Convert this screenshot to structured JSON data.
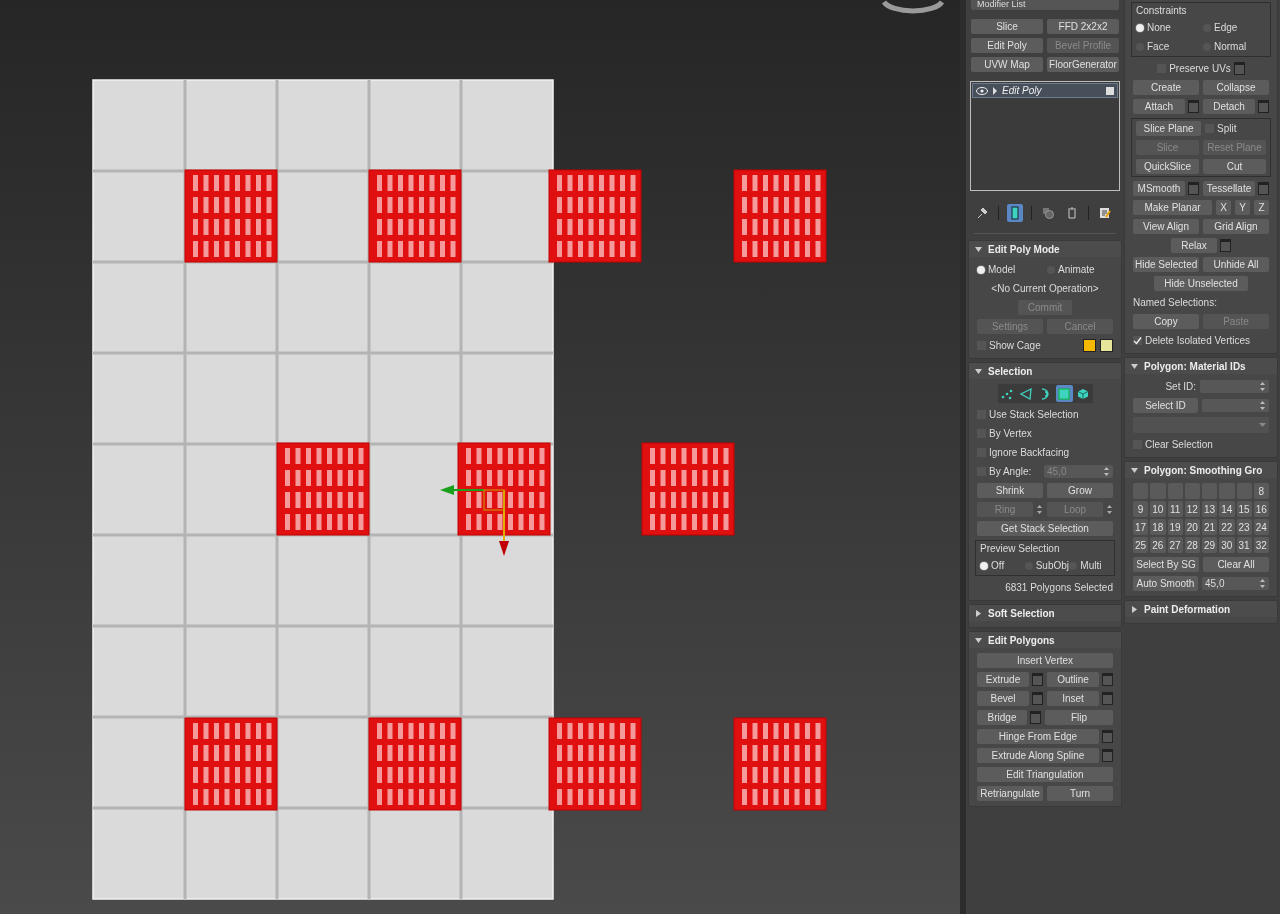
{
  "modifier_list": {
    "label": "Modifier List"
  },
  "modifier_buttons": [
    {
      "label": "Slice",
      "disabled": false
    },
    {
      "label": "FFD 2x2x2",
      "disabled": false
    },
    {
      "label": "Edit Poly",
      "disabled": false
    },
    {
      "label": "Bevel Profile",
      "disabled": true
    },
    {
      "label": "UVW Map",
      "disabled": false
    },
    {
      "label": "FloorGenerator",
      "disabled": false
    }
  ],
  "stack": [
    {
      "label": "Edit Poly",
      "selected": true
    }
  ],
  "stack_tools": [
    {
      "kind": "pin",
      "selected": false
    },
    {
      "kind": "show_end",
      "selected": true
    },
    {
      "kind": "unique",
      "selected": false
    },
    {
      "kind": "remove",
      "selected": false
    },
    {
      "kind": "configure",
      "selected": false
    }
  ],
  "columns": [
    {
      "sections": [
        {
          "title": "Edit Poly Mode",
          "expanded": true,
          "rows": [
            [
              {
                "kind": "radio",
                "label": "Model",
                "selected": true
              },
              {
                "kind": "radio",
                "label": "Animate",
                "selected": false
              }
            ],
            [
              {
                "kind": "text",
                "label": "<No Current Operation>"
              }
            ],
            [
              {
                "kind": "small_button",
                "label": "Commit",
                "disabled": true
              }
            ],
            [
              {
                "kind": "button",
                "label": "Settings",
                "disabled": true
              },
              {
                "kind": "button",
                "label": "Cancel",
                "disabled": true
              }
            ],
            [
              {
                "kind": "check",
                "label": "Show Cage",
                "checked": false
              },
              {
                "kind": "swatch",
                "color": "#f5b800"
              },
              {
                "kind": "swatch",
                "color": "#e6e49a"
              }
            ]
          ]
        },
        {
          "title": "Selection",
          "expanded": true,
          "rows": [
            [
              {
                "kind": "subobjects",
                "levels": [
                  {
                    "kind": "vertex",
                    "selected": false
                  },
                  {
                    "kind": "edge",
                    "selected": false
                  },
                  {
                    "kind": "border",
                    "selected": false
                  },
                  {
                    "kind": "polygon",
                    "selected": true
                  },
                  {
                    "kind": "element",
                    "selected": false
                  }
                ]
              }
            ],
            [
              {
                "kind": "check",
                "label": "Use Stack Selection",
                "checked": false
              }
            ],
            [
              {
                "kind": "check",
                "label": "By Vertex",
                "checked": false
              }
            ],
            [
              {
                "kind": "check",
                "label": "Ignore Backfacing",
                "checked": false
              }
            ],
            [
              {
                "kind": "check",
                "label": "By Angle:",
                "checked": false
              },
              {
                "kind": "spinner",
                "value": "45,0",
                "disabled": true
              }
            ],
            [
              {
                "kind": "button",
                "label": "Shrink",
                "disabled": false
              },
              {
                "kind": "button",
                "label": "Grow",
                "disabled": false
              }
            ],
            [
              {
                "kind": "spin_button",
                "label": "Ring",
                "disabled": true
              },
              {
                "kind": "spin_button",
                "label": "Loop",
                "disabled": true
              }
            ],
            [
              {
                "kind": "button",
                "label": "Get Stack Selection",
                "disabled": false
              }
            ],
            {
              "kind": "group",
              "title": "Preview Selection",
              "rows": [
                [
                  {
                    "kind": "radio",
                    "label": "Off",
                    "selected": true
                  },
                  {
                    "kind": "radio",
                    "label": "SubObj",
                    "selected": false
                  },
                  {
                    "kind": "radio",
                    "label": "Multi",
                    "selected": false
                  }
                ]
              ]
            },
            [
              {
                "kind": "status",
                "label": "6831 Polygons Selected"
              }
            ]
          ]
        },
        {
          "title": "Soft Selection",
          "expanded": false
        },
        {
          "title": "Edit Polygons",
          "expanded": true,
          "rows": [
            [
              {
                "kind": "button",
                "label": "Insert Vertex",
                "disabled": false
              }
            ],
            [
              {
                "kind": "setting_button",
                "label": "Extrude",
                "disabled": false
              },
              {
                "kind": "setting_button",
                "label": "Outline",
                "disabled": false
              }
            ],
            [
              {
                "kind": "setting_button",
                "label": "Bevel",
                "disabled": false
              },
              {
                "kind": "setting_button",
                "label": "Inset",
                "disabled": false
              }
            ],
            [
              {
                "kind": "setting_button",
                "label": "Bridge",
                "disabled": false
              },
              {
                "kind": "button",
                "label": "Flip",
                "disabled": false
              }
            ],
            [
              {
                "kind": "setting_button",
                "label": "Hinge From Edge",
                "disabled": false
              }
            ],
            [
              {
                "kind": "setting_button",
                "label": "Extrude Along Spline",
                "disabled": false
              }
            ],
            [
              {
                "kind": "button",
                "label": "Edit Triangulation",
                "disabled": false
              }
            ],
            [
              {
                "kind": "button",
                "label": "Retriangulate",
                "disabled": false
              },
              {
                "kind": "button",
                "label": "Turn",
                "disabled": false
              }
            ]
          ]
        }
      ]
    },
    {
      "sections": [
        {
          "rows": [
            {
              "kind": "group",
              "title": "Constraints",
              "rows": [
                [
                  {
                    "kind": "radio",
                    "label": "None",
                    "selected": true
                  },
                  {
                    "kind": "radio",
                    "label": "Edge",
                    "selected": false
                  }
                ],
                [
                  {
                    "kind": "radio",
                    "label": "Face",
                    "selected": false
                  },
                  {
                    "kind": "radio",
                    "label": "Normal",
                    "selected": false
                  }
                ]
              ]
            },
            [
              {
                "kind": "check_setting",
                "label": "Preserve UVs",
                "checked": false
              }
            ],
            [
              {
                "kind": "button",
                "label": "Create",
                "disabled": false
              },
              {
                "kind": "button",
                "label": "Collapse",
                "disabled": false
              }
            ],
            [
              {
                "kind": "setting_button",
                "label": "Attach",
                "disabled": false
              },
              {
                "kind": "setting_button",
                "label": "Detach",
                "disabled": false
              }
            ],
            {
              "kind": "group",
              "rows": [
                [
                  {
                    "kind": "button",
                    "label": "Slice Plane",
                    "disabled": false
                  },
                  {
                    "kind": "check",
                    "label": "Split",
                    "checked": false
                  }
                ],
                [
                  {
                    "kind": "button",
                    "label": "Slice",
                    "disabled": true
                  },
                  {
                    "kind": "button",
                    "label": "Reset Plane",
                    "disabled": true
                  }
                ],
                [
                  {
                    "kind": "button",
                    "label": "QuickSlice",
                    "disabled": false
                  },
                  {
                    "kind": "button",
                    "label": "Cut",
                    "disabled": false
                  }
                ]
              ]
            },
            [
              {
                "kind": "setting_button",
                "label": "MSmooth",
                "disabled": false
              },
              {
                "kind": "setting_button",
                "label": "Tessellate",
                "disabled": false
              }
            ],
            [
              {
                "kind": "button",
                "label": "Make Planar",
                "disabled": false
              },
              {
                "kind": "axis_button",
                "label": "X",
                "disabled": false
              },
              {
                "kind": "axis_button",
                "label": "Y",
                "disabled": false
              },
              {
                "kind": "axis_button",
                "label": "Z",
                "disabled": false
              }
            ],
            [
              {
                "kind": "button",
                "label": "View Align",
                "disabled": false
              },
              {
                "kind": "button",
                "label": "Grid Align",
                "disabled": false
              }
            ],
            [
              {
                "kind": "small_setting",
                "label": "Relax",
                "disabled": false
              }
            ],
            [
              {
                "kind": "button",
                "label": "Hide Selected",
                "disabled": false
              },
              {
                "kind": "button",
                "label": "Unhide All",
                "disabled": false
              }
            ],
            [
              {
                "kind": "small_button",
                "label": "Hide Unselected",
                "disabled": false
              }
            ],
            [
              {
                "kind": "label",
                "label": "Named Selections:"
              }
            ],
            [
              {
                "kind": "button",
                "label": "Copy",
                "disabled": false
              },
              {
                "kind": "button",
                "label": "Paste",
                "disabled": true
              }
            ],
            [
              {
                "kind": "check",
                "label": "Delete Isolated Vertices",
                "checked": true
              }
            ]
          ]
        },
        {
          "title": "Polygon: Material IDs",
          "expanded": true,
          "rows": [
            [
              {
                "kind": "field_label",
                "label": "Set ID:"
              },
              {
                "kind": "spinner",
                "disabled": false
              }
            ],
            [
              {
                "kind": "button",
                "label": "Select ID",
                "disabled": false
              },
              {
                "kind": "spinner",
                "disabled": false
              }
            ],
            [
              {
                "kind": "dropdown"
              }
            ],
            [
              {
                "kind": "check",
                "label": "Clear Selection",
                "checked": false
              }
            ]
          ]
        },
        {
          "title": "Polygon: Smoothing Gro",
          "expanded": true,
          "rows": [
            [
              {
                "kind": "sg_grid",
                "cells": [
                  {
                    "kind": "blank"
                  },
                  {
                    "kind": "blank"
                  },
                  {
                    "kind": "blank"
                  },
                  {
                    "kind": "blank"
                  },
                  {
                    "kind": "blank"
                  },
                  {
                    "kind": "blank"
                  },
                  {
                    "kind": "blank"
                  },
                  {
                    "kind": "number",
                    "label": "8"
                  },
                  {
                    "kind": "number",
                    "label": "9"
                  },
                  {
                    "kind": "number",
                    "label": "10"
                  },
                  {
                    "kind": "number",
                    "label": "11"
                  },
                  {
                    "kind": "number",
                    "label": "12"
                  },
                  {
                    "kind": "number",
                    "label": "13"
                  },
                  {
                    "kind": "number",
                    "label": "14"
                  },
                  {
                    "kind": "number",
                    "label": "15"
                  },
                  {
                    "kind": "number",
                    "label": "16"
                  },
                  {
                    "kind": "number",
                    "label": "17"
                  },
                  {
                    "kind": "number",
                    "label": "18"
                  },
                  {
                    "kind": "number",
                    "label": "19"
                  },
                  {
                    "kind": "number",
                    "label": "20"
                  },
                  {
                    "kind": "number",
                    "label": "21"
                  },
                  {
                    "kind": "number",
                    "label": "22"
                  },
                  {
                    "kind": "number",
                    "label": "23"
                  },
                  {
                    "kind": "number",
                    "label": "24"
                  },
                  {
                    "kind": "number",
                    "label": "25"
                  },
                  {
                    "kind": "number",
                    "label": "26"
                  },
                  {
                    "kind": "number",
                    "label": "27"
                  },
                  {
                    "kind": "number",
                    "label": "28"
                  },
                  {
                    "kind": "number",
                    "label": "29"
                  },
                  {
                    "kind": "number",
                    "label": "30"
                  },
                  {
                    "kind": "number",
                    "label": "31"
                  },
                  {
                    "kind": "number",
                    "label": "32"
                  }
                ]
              }
            ],
            [
              {
                "kind": "button",
                "label": "Select By SG",
                "disabled": false
              },
              {
                "kind": "button",
                "label": "Clear All",
                "disabled": false
              }
            ],
            [
              {
                "kind": "button",
                "label": "Auto Smooth",
                "disabled": false
              },
              {
                "kind": "spinner",
                "value": "45,0",
                "disabled": false
              }
            ]
          ]
        },
        {
          "title": "Paint Deformation",
          "expanded": false
        }
      ]
    }
  ]
}
